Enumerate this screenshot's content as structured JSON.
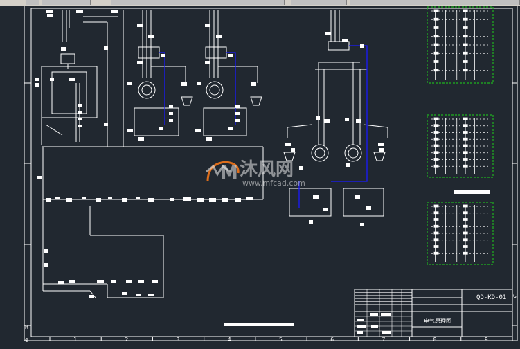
{
  "drawing": {
    "number": "QD-KD-01",
    "title": "电气原理图"
  },
  "watermark": {
    "name": "沐风网",
    "url": "www.mfcad.com",
    "logo_letter": "M",
    "icon": "mf-logo-icon"
  },
  "ruler": {
    "columns": [
      "1",
      "2",
      "3",
      "4",
      "5",
      "6",
      "7",
      "8",
      "9"
    ],
    "row_labels": [
      "H",
      "G"
    ],
    "corner": "0"
  },
  "colors": {
    "background": "#212830",
    "line": "#ffffff",
    "accent_blue": "#1a1aff",
    "panel_green": "#1fb31f"
  }
}
